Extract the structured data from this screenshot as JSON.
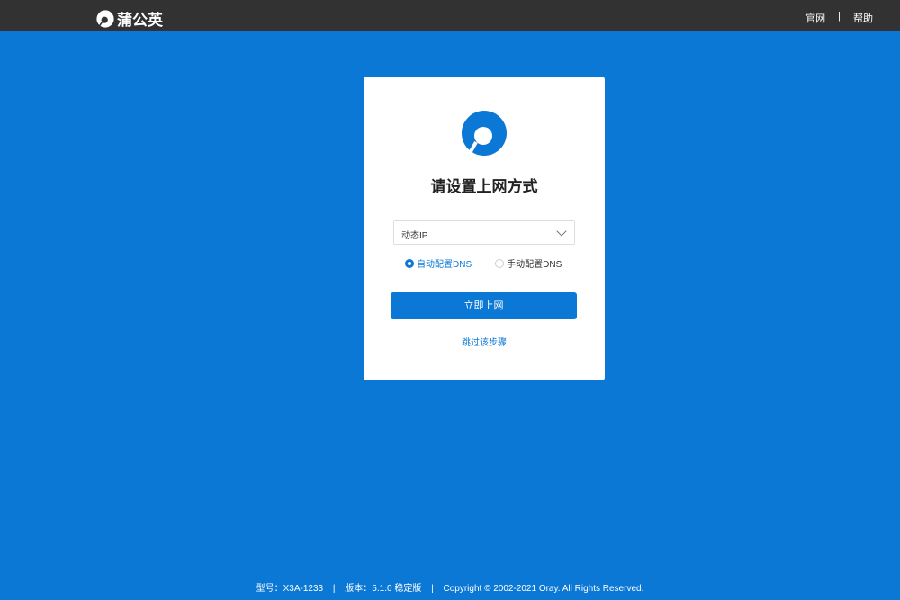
{
  "topbar": {
    "brand": "蒲公英",
    "links": [
      "官网",
      "|",
      "帮助"
    ]
  },
  "card": {
    "title": "请设置上网方式",
    "select_value": "动态IP",
    "radios": [
      {
        "label": "自动配置DNS",
        "checked": true
      },
      {
        "label": "手动配置DNS",
        "checked": false
      }
    ],
    "submit": "立即上网",
    "skip": "跳过该步骤"
  },
  "footer": {
    "model": "型号：X3A-1233",
    "sep": "|",
    "version": "版本：5.1.0 稳定版",
    "copyright": "Copyright © 2002-2021 Oray. All Rights Reserved."
  },
  "colors": {
    "accent": "#0b78d6",
    "topbar": "#323232"
  }
}
